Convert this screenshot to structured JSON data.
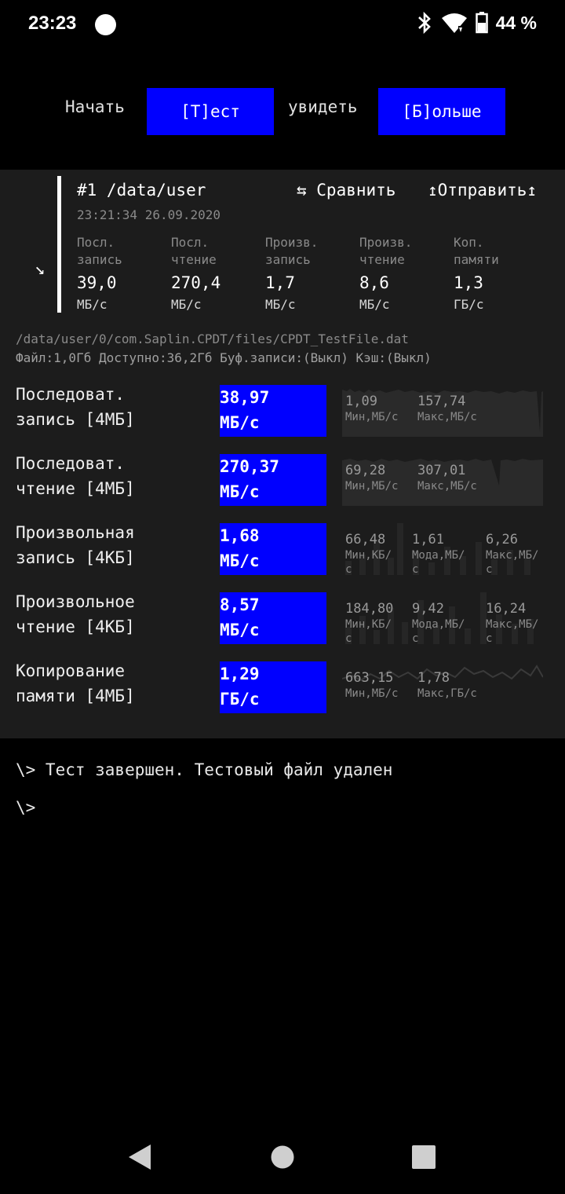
{
  "status_bar": {
    "time": "23:23",
    "battery": "44 %"
  },
  "toolbar": {
    "start_label": "Начать",
    "test_button": "[Т]ест",
    "see_label": "увидеть",
    "more_button": "[Б]ольше"
  },
  "result": {
    "title": "#1 /data/user",
    "compare": "⇆ Сравнить",
    "send": "↥Отправить↥",
    "datetime": "23:21:34 26.09.2020",
    "columns": [
      {
        "label1": "Посл.",
        "label2": "запись",
        "value": "39,0",
        "unit": "МБ/с"
      },
      {
        "label1": "Посл.",
        "label2": "чтение",
        "value": "270,4",
        "unit": "МБ/с"
      },
      {
        "label1": "Произв.",
        "label2": "запись",
        "value": "1,7",
        "unit": "МБ/с"
      },
      {
        "label1": "Произв.",
        "label2": "чтение",
        "value": "8,6",
        "unit": "МБ/с"
      },
      {
        "label1": "Коп.",
        "label2": "памяти",
        "value": "1,3",
        "unit": "ГБ/с"
      }
    ]
  },
  "file": {
    "path": "/data/user/0/com.Saplin.CPDT/files/CPDT_TestFile.dat",
    "info": "Файл:1,0Гб Доступно:36,2Гб Буф.записи:(Выкл) Кэш:(Выкл)"
  },
  "tests": [
    {
      "name1": "Последоват.",
      "name2": "запись [4МБ]",
      "value1": "38,97",
      "value2": "МБ/с",
      "stats": [
        {
          "v": "1,09",
          "l1": "Мин,МБ/с",
          "l2": ""
        },
        {
          "v": "157,74",
          "l1": "Макс,МБ/с",
          "l2": ""
        }
      ]
    },
    {
      "name1": "Последоват.",
      "name2": "чтение [4МБ]",
      "value1": "270,37",
      "value2": "МБ/с",
      "stats": [
        {
          "v": "69,28",
          "l1": "Мин,МБ/с",
          "l2": ""
        },
        {
          "v": "307,01",
          "l1": "Макс,МБ/с",
          "l2": ""
        }
      ]
    },
    {
      "name1": "Произвольная",
      "name2": "запись [4КБ]",
      "value1": "1,68",
      "value2": "МБ/с",
      "stats": [
        {
          "v": "66,48",
          "l1": "Мин,КБ/",
          "l2": "с"
        },
        {
          "v": "1,61",
          "l1": "Мода,МБ/",
          "l2": "с"
        },
        {
          "v": "6,26",
          "l1": "Макс,МБ/",
          "l2": "с"
        }
      ]
    },
    {
      "name1": "Произвольное",
      "name2": "чтение [4КБ]",
      "value1": "8,57",
      "value2": "МБ/с",
      "stats": [
        {
          "v": "184,80",
          "l1": "Мин,КБ/",
          "l2": "с"
        },
        {
          "v": "9,42",
          "l1": "Мода,МБ/",
          "l2": "с"
        },
        {
          "v": "16,24",
          "l1": "Макс,МБ/",
          "l2": "с"
        }
      ]
    },
    {
      "name1": "Копирование",
      "name2": "памяти [4МБ]",
      "value1": "1,29",
      "value2": "ГБ/с",
      "stats": [
        {
          "v": "663,15",
          "l1": "Мин,МБ/с",
          "l2": ""
        },
        {
          "v": "1,78",
          "l1": "Макс,ГБ/с",
          "l2": ""
        }
      ]
    }
  ],
  "console": {
    "line1": "\\> Тест завершен. Тестовый файл удален",
    "line2": "\\>"
  }
}
